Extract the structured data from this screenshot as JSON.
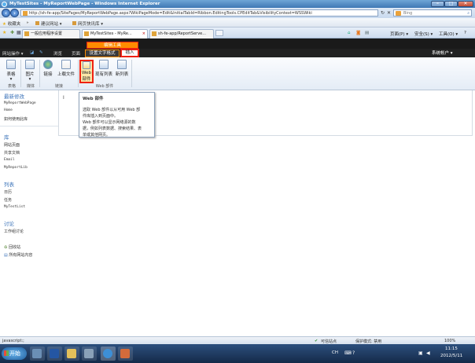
{
  "window": {
    "title": "MyTestSites - MyReportWebPage - Windows Internet Explorer",
    "min": "–",
    "max": "□",
    "close": "✕"
  },
  "addressbar": {
    "url": "http://sh-fe-app/SiteFages/MyReportWebPage.aspx?WikiPageMode=Edit&InitialTabId=Ribbon.EditingTools.CPEditTab&VisibilityContext=WSSWiki",
    "refresh": "↻",
    "stop": "✕",
    "search_placeholder": "Bing"
  },
  "favorites": {
    "label": "收藏夹",
    "items": [
      "建议网站 ▾",
      "网页快讯库 ▾"
    ]
  },
  "tabs": {
    "items": [
      {
        "label": "一般应用程序设置"
      },
      {
        "label": "MyTestSites - MyRe..."
      },
      {
        "label": "sh-fe-app/ReportServe..."
      }
    ],
    "page_menu": "页面(P) ▾",
    "safety_menu": "安全(S) ▾",
    "tools_menu": "工具(O) ▾",
    "help": "?"
  },
  "sp_ribbon": {
    "site_actions": "网站操作 ▾",
    "browse": "浏览",
    "page": "页面",
    "ctx_group": "编辑工具",
    "ctx_tab_format": "设置文字格式",
    "ctx_tab_insert": "插入",
    "user": "系统帐户 ▾",
    "buttons": {
      "table": "表格",
      "picture": "图片",
      "link": "链接",
      "upload": "上载文件",
      "webpart": "Web 部件",
      "existing_list": "现有列表",
      "new_list": "新列表"
    },
    "groups": {
      "tables": "表格",
      "media": "媒体",
      "links": "链接",
      "webparts": "Web 部件"
    }
  },
  "quicklaunch": {
    "recent_header": "最新修改",
    "recent": [
      "MyReportWebPage",
      "Home",
      "如何使用此库"
    ],
    "libraries_header": "库",
    "libraries": [
      "网站页面",
      "共享文档",
      "Email",
      "MyReportLib"
    ],
    "lists_header": "列表",
    "lists": [
      "日历",
      "任务",
      "MyTestList"
    ],
    "discussions_header": "讨论",
    "discussions": [
      "工作组讨论"
    ],
    "recycle_bin": "回收站",
    "all_content": "所有网站内容"
  },
  "editor": {
    "cursor": "I"
  },
  "tooltip": {
    "title": "Web 部件",
    "lines": [
      "选取 Web 部件以从可用 Web 部",
      "件库插入到页面中。",
      "Web 部件可以显示网络源的数",
      "据，例如列表数据、搜索结果、表",
      "单或其他网页。"
    ]
  },
  "statusbar": {
    "left": "javascript:;",
    "zone": "可信站点",
    "protected_mode": "保护模式: 禁用",
    "zoom": "100%"
  },
  "taskbar": {
    "start": "开始",
    "lang": "CH",
    "time": "11:15",
    "date": "2012/5/11"
  }
}
